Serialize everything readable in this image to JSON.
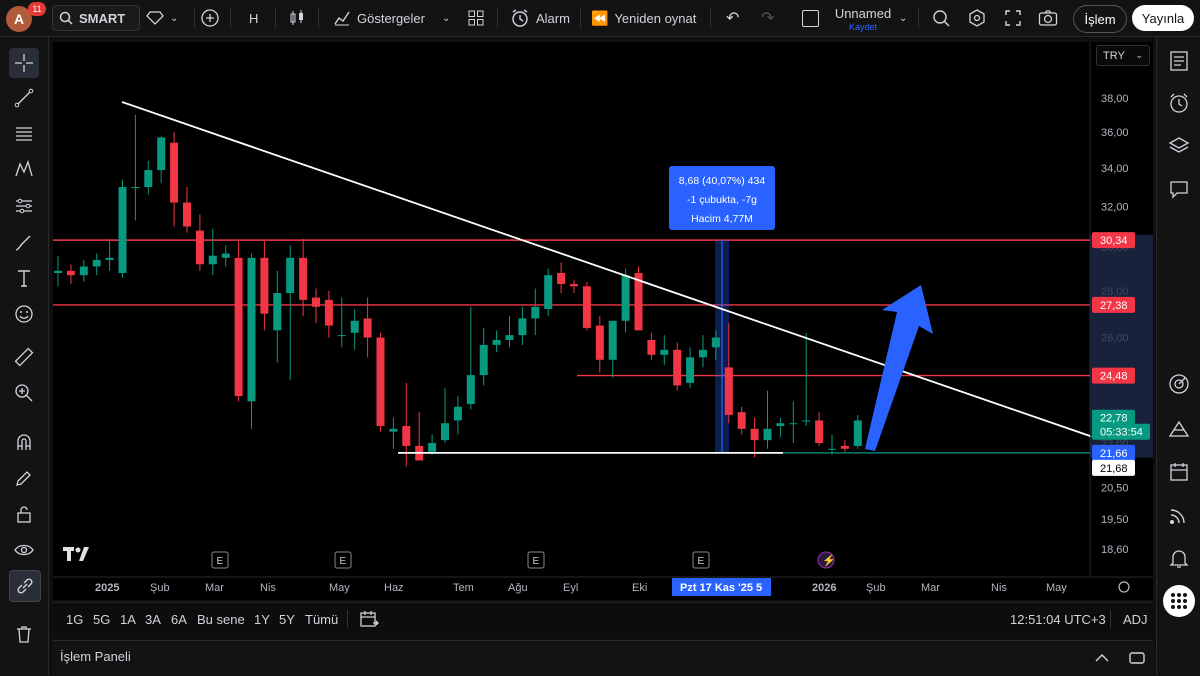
{
  "toolbar": {
    "avatar_letter": "A",
    "notification_count": "11",
    "symbol": "SMART",
    "interval": "H",
    "indicators": "Göstergeler",
    "alarm": "Alarm",
    "replay": "Yeniden oynat",
    "layout_name": "Unnamed",
    "layout_save": "Kaydet",
    "trade": "İşlem",
    "publish": "Yayınla"
  },
  "chart": {
    "currency": "TRY",
    "price_axis": [
      "38,00",
      "36,00",
      "34,00",
      "32,00",
      "30,00",
      "28,00",
      "26,00",
      "22,00",
      "20,50",
      "19,50",
      "18,60"
    ],
    "price_badges": [
      {
        "label": "30,34",
        "color": "#f23645"
      },
      {
        "label": "27,38",
        "color": "#f23645"
      },
      {
        "label": "24,48",
        "color": "#f23645"
      },
      {
        "label": "22,78",
        "color": "#089981"
      },
      {
        "label": "05:33:54",
        "color": "#089981"
      },
      {
        "label": "21,66",
        "color": "#2962ff"
      },
      {
        "label": "21,68",
        "color": "#ffffff"
      }
    ],
    "time_axis": [
      "2025",
      "Şub",
      "Mar",
      "Nis",
      "May",
      "Haz",
      "Tem",
      "Ağu",
      "Eyl",
      "Eki",
      "2026",
      "Şub",
      "Mar",
      "Nis",
      "May"
    ],
    "time_cursor_label": "Pzt 17 Kas '25   5",
    "measure_tooltip": {
      "line1": "8,68 (40,07%) 434",
      "line2": "-1 çubukta, -7g",
      "line3": "Hacim 4,77M"
    },
    "earnings_marker": "E",
    "colors": {
      "up": "#089981",
      "down": "#f23645",
      "line": "#ffffff",
      "arrow": "#2962ff",
      "hline": "#f23645"
    }
  },
  "chart_data": {
    "type": "candlestick",
    "currency": "TRY",
    "ohlc": [
      [
        28.8,
        29.6,
        28.2,
        28.9
      ],
      [
        28.9,
        29.2,
        28.3,
        28.7
      ],
      [
        28.7,
        29.4,
        28.4,
        29.1
      ],
      [
        29.1,
        29.7,
        28.7,
        29.4
      ],
      [
        29.4,
        30.4,
        28.9,
        29.5
      ],
      [
        28.8,
        33.4,
        28.6,
        33.0
      ],
      [
        33.0,
        37.0,
        31.3,
        33.0
      ],
      [
        33.0,
        34.4,
        32.6,
        33.9
      ],
      [
        33.9,
        35.8,
        33.2,
        35.7
      ],
      [
        35.4,
        36.0,
        31.0,
        32.2
      ],
      [
        32.2,
        33.0,
        30.7,
        31.0
      ],
      [
        30.8,
        31.6,
        28.9,
        29.2
      ],
      [
        29.2,
        30.9,
        28.7,
        29.6
      ],
      [
        29.5,
        30.1,
        29.1,
        29.7
      ],
      [
        29.5,
        30.3,
        23.5,
        23.7
      ],
      [
        23.5,
        29.7,
        22.5,
        29.5
      ],
      [
        29.5,
        30.3,
        26.3,
        27.0
      ],
      [
        26.3,
        28.9,
        25.0,
        27.9
      ],
      [
        27.9,
        30.1,
        24.3,
        29.5
      ],
      [
        29.5,
        30.4,
        26.9,
        27.6
      ],
      [
        27.7,
        28.1,
        26.6,
        27.3
      ],
      [
        27.6,
        28.0,
        26.0,
        26.5
      ],
      [
        26.1,
        27.7,
        25.6,
        26.1
      ],
      [
        26.2,
        27.2,
        25.5,
        26.7
      ],
      [
        26.8,
        27.7,
        25.2,
        26.0
      ],
      [
        26.0,
        26.2,
        22.4,
        22.6
      ],
      [
        22.4,
        22.9,
        21.8,
        22.5
      ],
      [
        22.6,
        24.2,
        21.2,
        21.9
      ],
      [
        21.9,
        23.1,
        21.6,
        21.4
      ],
      [
        21.7,
        22.3,
        21.6,
        22.0
      ],
      [
        22.1,
        24.0,
        22.0,
        22.7
      ],
      [
        22.8,
        23.7,
        22.3,
        23.3
      ],
      [
        23.4,
        27.3,
        23.2,
        24.5
      ],
      [
        24.5,
        26.4,
        24.1,
        25.7
      ],
      [
        25.7,
        26.3,
        25.4,
        25.9
      ],
      [
        25.9,
        26.9,
        25.6,
        26.1
      ],
      [
        26.1,
        27.3,
        25.7,
        26.8
      ],
      [
        26.8,
        28.1,
        26.1,
        27.3
      ],
      [
        27.2,
        29.0,
        26.9,
        28.7
      ],
      [
        28.8,
        29.3,
        27.9,
        28.3
      ],
      [
        28.3,
        28.5,
        27.9,
        28.2
      ],
      [
        28.2,
        28.4,
        26.3,
        26.4
      ],
      [
        26.5,
        26.9,
        24.6,
        25.1
      ],
      [
        25.1,
        26.5,
        24.4,
        26.7
      ],
      [
        26.7,
        29.0,
        26.2,
        28.7
      ],
      [
        28.8,
        29.1,
        26.3,
        26.3
      ],
      [
        25.9,
        26.2,
        25.1,
        25.3
      ],
      [
        25.3,
        26.1,
        24.9,
        25.5
      ],
      [
        25.5,
        25.8,
        23.9,
        24.1
      ],
      [
        24.2,
        25.6,
        24.0,
        25.2
      ],
      [
        25.2,
        26.1,
        24.8,
        25.5
      ],
      [
        25.6,
        26.3,
        25.1,
        26.0
      ],
      [
        24.8,
        26.6,
        22.7,
        23.0
      ],
      [
        23.1,
        23.3,
        22.3,
        22.5
      ],
      [
        22.5,
        22.9,
        21.5,
        22.1
      ],
      [
        22.1,
        23.9,
        21.8,
        22.5
      ],
      [
        22.6,
        22.9,
        22.2,
        22.7
      ],
      [
        22.7,
        23.5,
        22.0,
        22.7
      ],
      [
        22.8,
        26.2,
        22.6,
        22.8
      ],
      [
        22.8,
        23.1,
        21.9,
        22.0
      ],
      [
        21.8,
        22.3,
        21.6,
        21.8
      ],
      [
        21.9,
        22.1,
        21.7,
        21.8
      ],
      [
        21.9,
        23.0,
        21.8,
        22.8
      ]
    ],
    "horizontal_lines": [
      30.34,
      27.38,
      24.48
    ],
    "support_line": 21.66,
    "last_price": 22.78,
    "ylim": [
      18.2,
      39.5
    ]
  },
  "controls": {
    "ranges": [
      "1G",
      "5G",
      "1A",
      "3A",
      "6A",
      "Bu sene",
      "1Y",
      "5Y",
      "Tümü"
    ],
    "clock": "12:51:04 UTC+3",
    "adj": "ADJ"
  },
  "bottom": {
    "panel": "İşlem Paneli"
  }
}
